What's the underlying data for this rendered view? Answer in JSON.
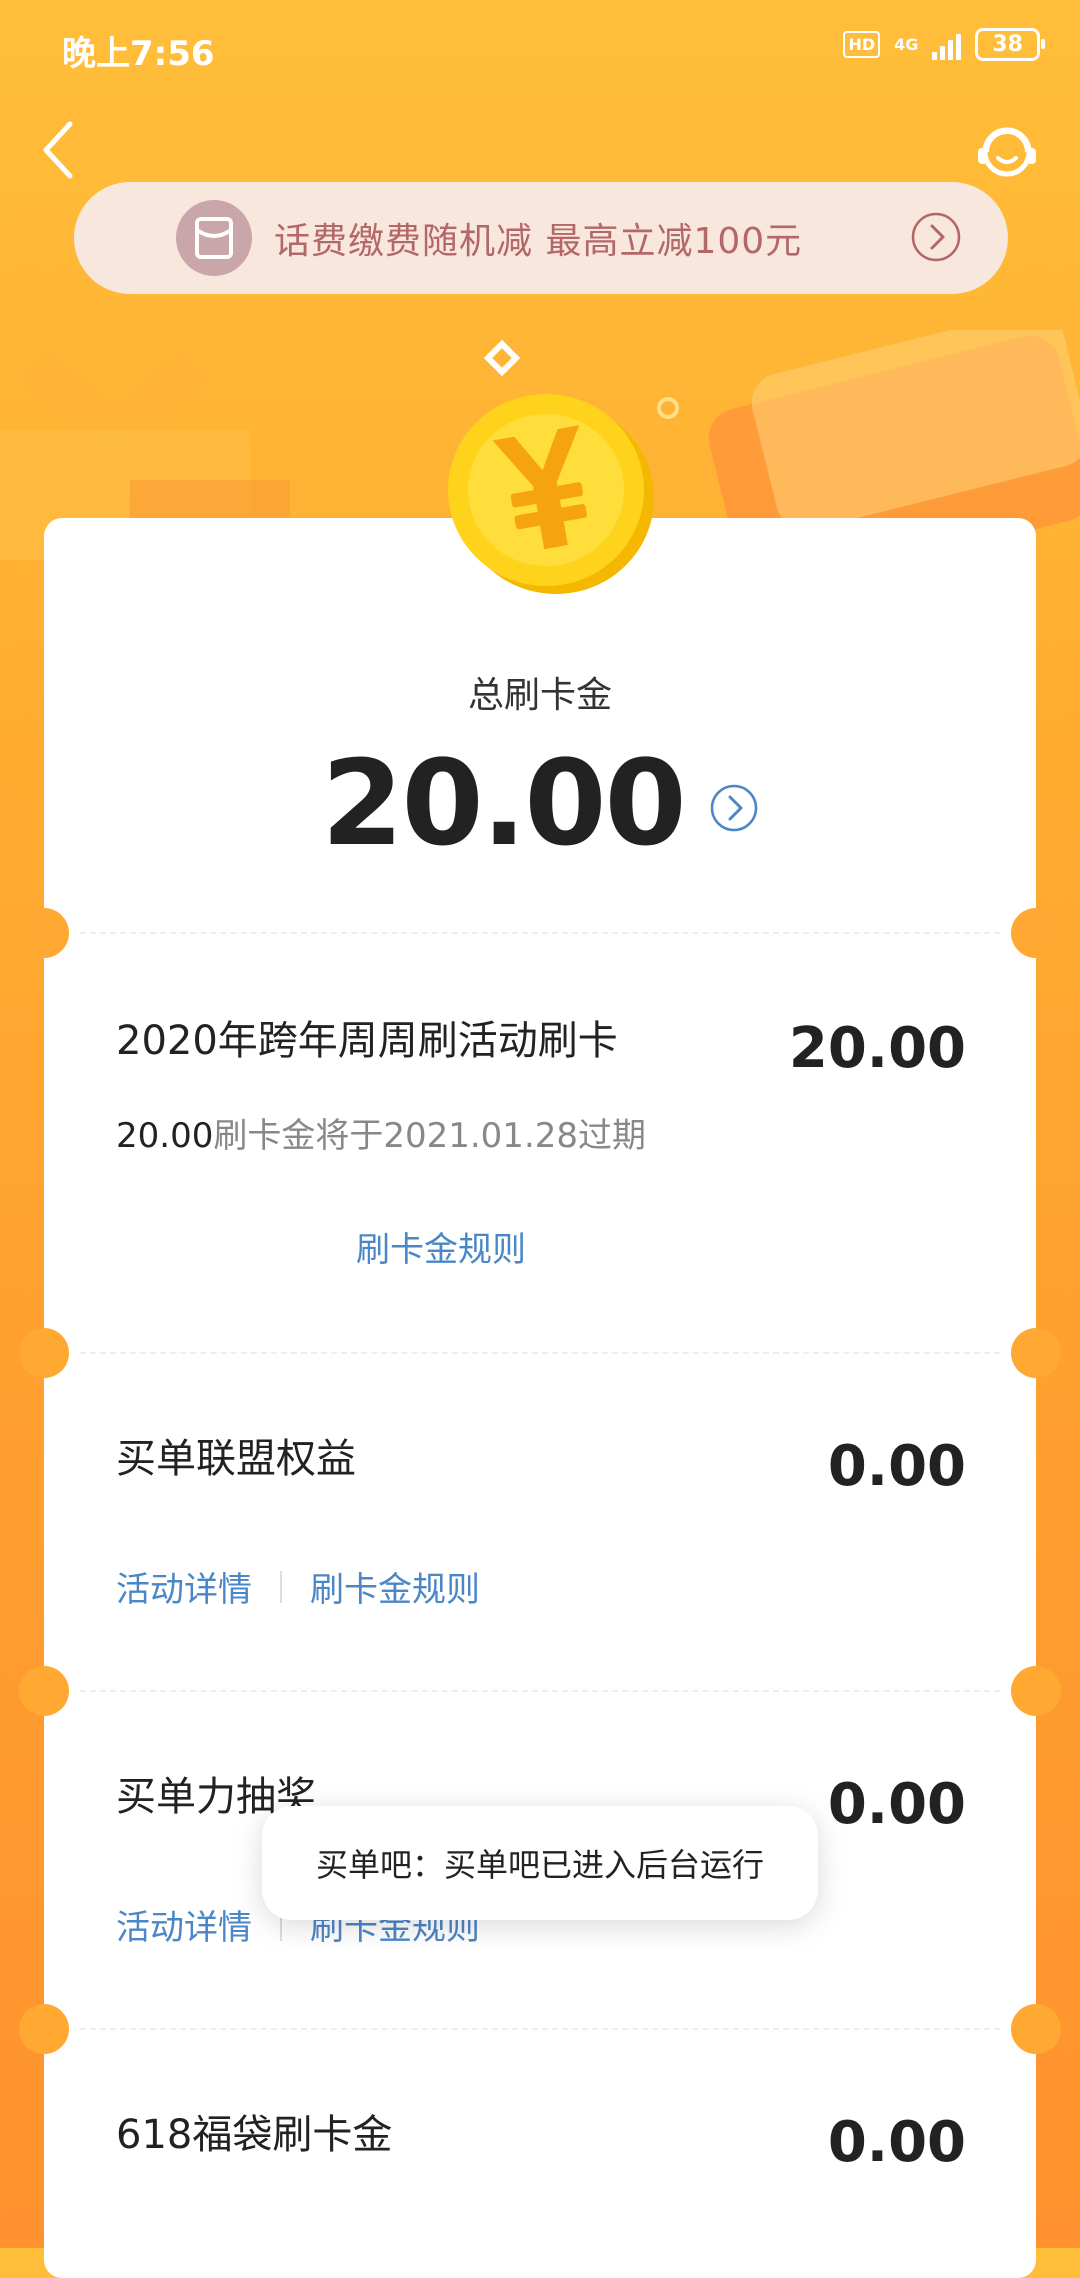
{
  "status_bar": {
    "time": "晚上7:56",
    "hd": "HD",
    "network": "4G",
    "battery": "38"
  },
  "banner": {
    "text": "话费缴费随机减 最高立减100元"
  },
  "summary": {
    "label": "总刷卡金",
    "total": "20.00"
  },
  "sections": [
    {
      "title": "2020年跨年周周刷活动刷卡",
      "amount": "20.00",
      "sub_amount": "20.00",
      "sub_text": "刷卡金将于2021.01.28过期",
      "links": [
        "刷卡金规则"
      ]
    },
    {
      "title": "买单联盟权益",
      "amount": "0.00",
      "links": [
        "活动详情",
        "刷卡金规则"
      ]
    },
    {
      "title": "买单力抽奖",
      "amount": "0.00",
      "links": [
        "活动详情",
        "刷卡金规则"
      ]
    },
    {
      "title": "618福袋刷卡金",
      "amount": "0.00"
    }
  ],
  "toast": {
    "text": "买单吧：买单吧已进入后台运行"
  },
  "colors": {
    "accent": "#ffa832",
    "link": "#4b86c7"
  },
  "icons": [
    "back-arrow-icon",
    "customer-service-icon",
    "red-envelope-icon",
    "chevron-right-icon",
    "coin-icon"
  ]
}
